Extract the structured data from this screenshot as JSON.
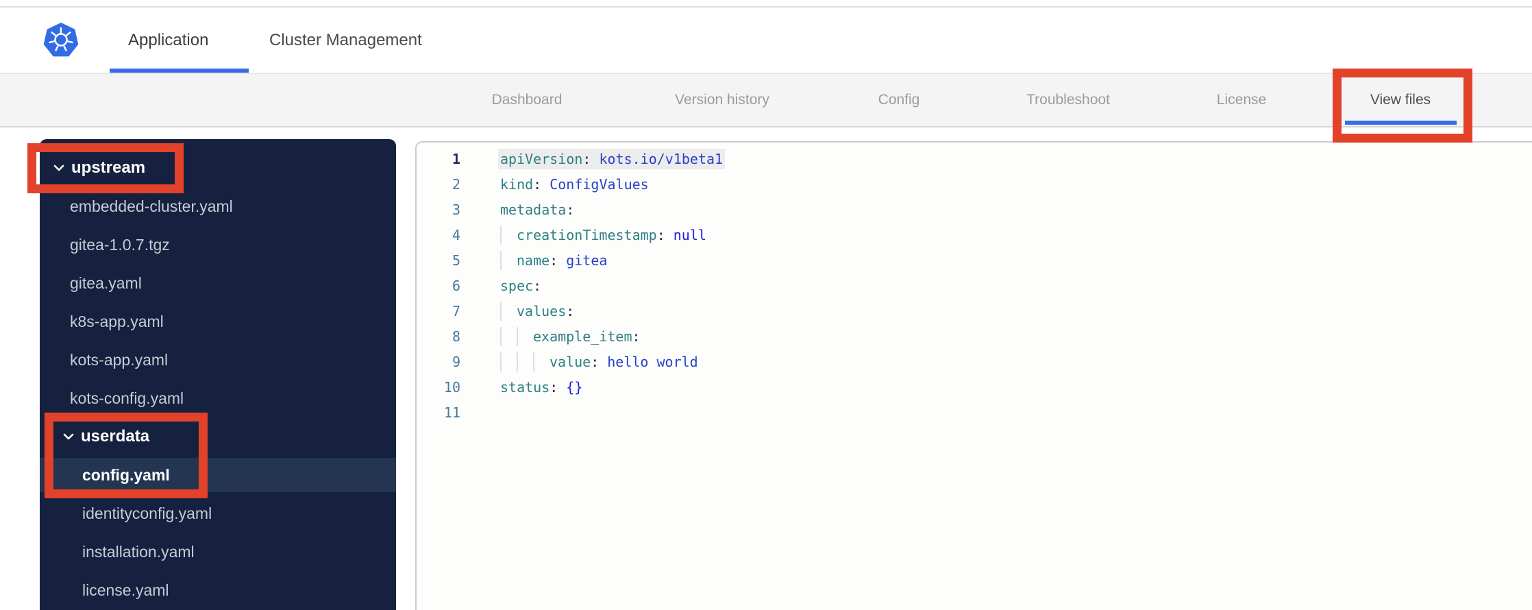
{
  "top_nav": {
    "logo": "kubernetes-logo",
    "tabs": [
      {
        "label": "Application",
        "active": true
      },
      {
        "label": "Cluster Management",
        "active": false
      }
    ]
  },
  "app_nav": {
    "tabs": [
      {
        "label": "Dashboard",
        "active": false
      },
      {
        "label": "Version history",
        "active": false
      },
      {
        "label": "Config",
        "active": false
      },
      {
        "label": "Troubleshoot",
        "active": false
      },
      {
        "label": "License",
        "active": false
      },
      {
        "label": "View files",
        "active": true
      }
    ]
  },
  "file_tree": {
    "items": [
      {
        "label": "upstream",
        "type": "folder",
        "expanded": true,
        "annotated": true
      },
      {
        "label": "embedded-cluster.yaml",
        "type": "file"
      },
      {
        "label": "gitea-1.0.7.tgz",
        "type": "file"
      },
      {
        "label": "gitea.yaml",
        "type": "file"
      },
      {
        "label": "k8s-app.yaml",
        "type": "file"
      },
      {
        "label": "kots-app.yaml",
        "type": "file"
      },
      {
        "label": "kots-config.yaml",
        "type": "file"
      },
      {
        "label": "userdata",
        "type": "folder",
        "expanded": true,
        "annotated": true
      },
      {
        "label": "config.yaml",
        "type": "file",
        "selected": true,
        "annotated": true
      },
      {
        "label": "identityconfig.yaml",
        "type": "file"
      },
      {
        "label": "installation.yaml",
        "type": "file"
      },
      {
        "label": "license.yaml",
        "type": "file"
      }
    ]
  },
  "editor": {
    "colon": ":",
    "lines": [
      {
        "num": "1",
        "indent": 0,
        "key": "apiVersion",
        "value": "kots.io/v1beta1",
        "current": true
      },
      {
        "num": "2",
        "indent": 0,
        "key": "kind",
        "value": "ConfigValues"
      },
      {
        "num": "3",
        "indent": 0,
        "key": "metadata",
        "value": ""
      },
      {
        "num": "4",
        "indent": 1,
        "key": "creationTimestamp",
        "value": "null",
        "keyword": true
      },
      {
        "num": "5",
        "indent": 1,
        "key": "name",
        "value": "gitea"
      },
      {
        "num": "6",
        "indent": 0,
        "key": "spec",
        "value": ""
      },
      {
        "num": "7",
        "indent": 1,
        "key": "values",
        "value": ""
      },
      {
        "num": "8",
        "indent": 2,
        "key": "example_item",
        "value": ""
      },
      {
        "num": "9",
        "indent": 3,
        "key": "value",
        "value": "hello world"
      },
      {
        "num": "10",
        "indent": 0,
        "key": "status",
        "value": "{}",
        "keyword": true
      },
      {
        "num": "11"
      }
    ]
  },
  "annotations": {
    "color": "#e2422a",
    "boxes": [
      "upstream-folder",
      "userdata-and-config-yaml",
      "view-files-tab"
    ]
  },
  "colors": {
    "accent_blue": "#3a6ce8",
    "logo_blue": "#326ce5",
    "annotation_red": "#e2422a",
    "sidebar_bg": "#15213e",
    "sidebar_selected_bg": "#233551",
    "code_key": "#2e7f87",
    "code_value": "#2941c9",
    "code_keyword": "#1a1dd8",
    "line_number": "#447a9e"
  }
}
